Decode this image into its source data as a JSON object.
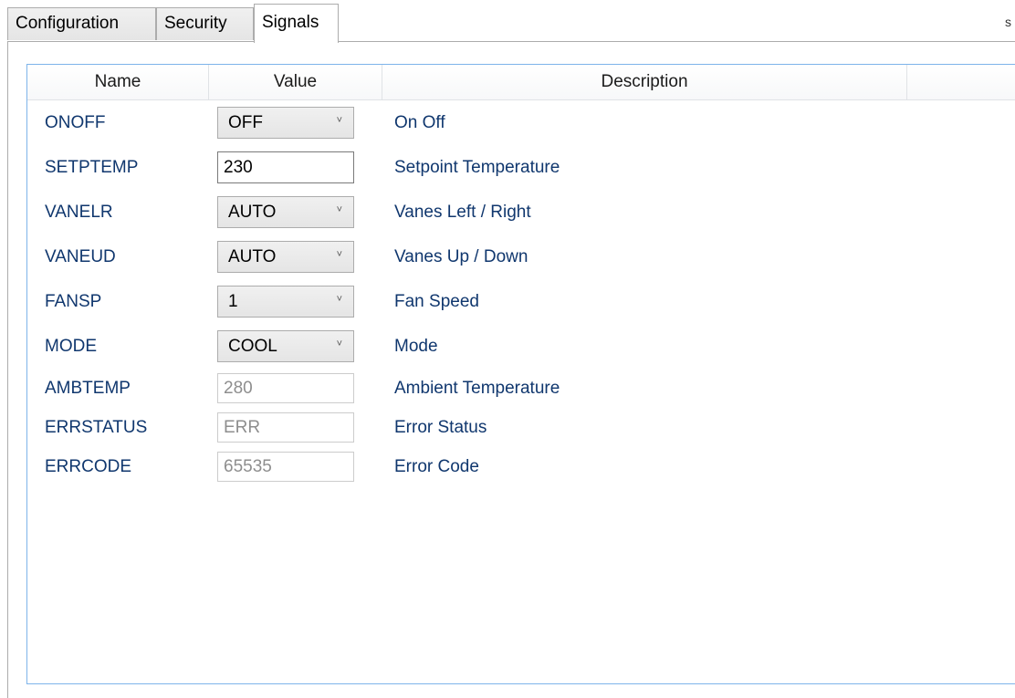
{
  "tabs": [
    {
      "label": "Configuration"
    },
    {
      "label": "Security"
    },
    {
      "label": "Signals"
    }
  ],
  "active_tab": "Signals",
  "overflow_mark": "s",
  "grid": {
    "columns": [
      "Name",
      "Value",
      "Description",
      ""
    ],
    "rows": [
      {
        "name": "ONOFF",
        "value": "OFF",
        "control": "combo",
        "description": "On Off"
      },
      {
        "name": "SETPTEMP",
        "value": "230",
        "control": "textbox",
        "description": "Setpoint Temperature"
      },
      {
        "name": "VANELR",
        "value": "AUTO",
        "control": "combo",
        "description": "Vanes Left / Right"
      },
      {
        "name": "VANEUD",
        "value": "AUTO",
        "control": "combo",
        "description": "Vanes Up / Down"
      },
      {
        "name": "FANSP",
        "value": "1",
        "control": "combo",
        "description": "Fan Speed"
      },
      {
        "name": "MODE",
        "value": "COOL",
        "control": "combo",
        "description": "Mode"
      },
      {
        "name": "AMBTEMP",
        "value": "280",
        "control": "readonly",
        "description": "Ambient Temperature"
      },
      {
        "name": "ERRSTATUS",
        "value": "ERR",
        "control": "readonly",
        "description": "Error Status"
      },
      {
        "name": "ERRCODE",
        "value": "65535",
        "control": "readonly",
        "description": "Error Code"
      }
    ]
  },
  "icons": {
    "combo_arrow": "chevron-down-icon",
    "combo_arrow_glyph": "˅"
  },
  "colors": {
    "label_text": "#10376e",
    "grid_border": "#7eb4ea",
    "tab_border": "#acacac",
    "readonly_text": "#8e8e8e"
  }
}
